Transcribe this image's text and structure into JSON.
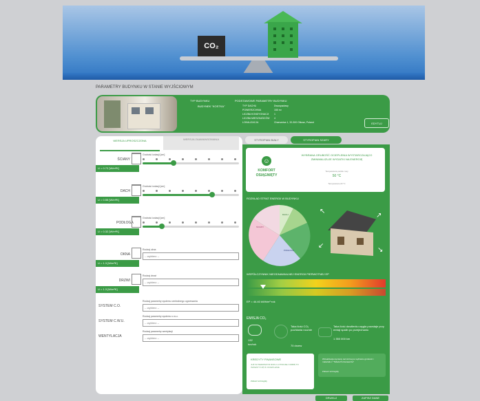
{
  "hero": {
    "co2_label": "CO₂"
  },
  "section_title": "PARAMETRY BUDYNKU W STANIE WYJŚCIOWYM",
  "info": {
    "typ_heading": "TYP BUDYNKU",
    "typ_value": "BUDYNEK \"KOSTKA\"",
    "podst_heading": "PODSTAWOWE PARAMETRY BUDYNKU",
    "rows": [
      {
        "k": "TYP DACHU",
        "v": "Dwuspadowy"
      },
      {
        "k": "POWIERZCHNIA",
        "v": "150 m²"
      },
      {
        "k": "LICZBA KONDYGNACJI",
        "v": "1"
      },
      {
        "k": "LICZBA MIESZKAŃCÓW",
        "v": "4"
      },
      {
        "k": "LOKALIZACJA",
        "v": "Charsznica 1, 32-300 Olkusz, Poland"
      }
    ],
    "edit_button": "EDYTUJ"
  },
  "left_tabs": [
    "WERSJA UPROSZCZONA",
    "WERSJA ZAAWANSOWANA"
  ],
  "right_tabs": [
    "STYROPIAN BIAŁY",
    "STYROPIAN SZARY"
  ],
  "partitions": [
    {
      "name": "ŚCIANY",
      "u": "U = 0.72 [W/m²K]",
      "field": "Grubość izolacji [cm]",
      "pos": 0.32
    },
    {
      "name": "DACH",
      "u": "U = 0.55 [W/m²K]",
      "field": "Grubość izolacji [cm]",
      "pos": 0.72
    },
    {
      "name": "PODŁOGA",
      "u": "U = 0.32 [W/m²K]",
      "field": "Grubość izolacji [cm]",
      "pos": 0.2
    }
  ],
  "selects": [
    {
      "name": "OKNA",
      "u": "U = 1.3 [W/m²K]",
      "field": "Rodzaj okna",
      "value": "-- wybierz --"
    },
    {
      "name": "DRZWI",
      "u": "U = 1.3 [W/m²K]",
      "field": "Rodzaj drzwi",
      "value": "-- wybierz --"
    }
  ],
  "systems": [
    {
      "name": "SYSTEM C.O.",
      "field": "Rodzaj parametry systemu centralnego ogrzewania",
      "value": "-- wybierz --"
    },
    {
      "name": "SYSTEM C.W.U.",
      "field": "Rodzaj parametry systemu c.w.u.",
      "value": "-- wybierz --"
    },
    {
      "name": "WENTYLACJA",
      "field": "Rodzaj parametry wentylacji",
      "value": "-- wybierz --"
    }
  ],
  "comfort": {
    "label1": "KOMFORT",
    "label2": "OSIĄGNIĘTY",
    "msg": "WYBRANA GRUBOŚĆ OCIEPLENIA WYSTARCZAJĄCO ZMINIMALIZUJE WYDATKI NA ENERGIĘ",
    "temp": "50 °C",
    "sub1": "Temperatura punktu rosy",
    "sub2": "Temperatura 20 °C"
  },
  "losses_title": "ROZKŁAD STRAT ENERGII W BUDYNKU",
  "pie_labels": [
    "ŚCIANY",
    "DACH",
    "PODŁOGA",
    "WENTYLACJA",
    "OKNA",
    "DRZWI"
  ],
  "ep": {
    "title": "WSPÓŁCZYNNIK NIEODNAWIALNEJ ENERGII PIERWOTNEJ EP",
    "value": "EP = 44.40 kWh/m²·rok"
  },
  "emission": {
    "title": "EMISJA CO₂",
    "value": "132",
    "unit": "ton/rok",
    "t1": "Taka ilość CO₂ pochłania rocznie",
    "t1b": "70 drzew",
    "t2": "Taka ilość dwutlenku węgla powstaje przy emisji spalin po przejechaniu",
    "t2b": "1 350 000 km"
  },
  "bottom": {
    "credit_title": "KREDYTY FINANSOWE",
    "credit_text": "JUŻ W PIERWSZYM ROKU LOTNICZEJ ODBIĘ TO INWESTYCJĘ W OCIEPLENIE",
    "credit_link": "Zobacz szczegóły",
    "green_text": "Wizualizacja wymiany termicznej po wybraniu grubości i materiału z \"Tabela Porównawcza\"",
    "green_link": "Zobacz szczegóły"
  },
  "footer_buttons": [
    "DRUKUJ",
    "ZAPISZ DANE"
  ]
}
